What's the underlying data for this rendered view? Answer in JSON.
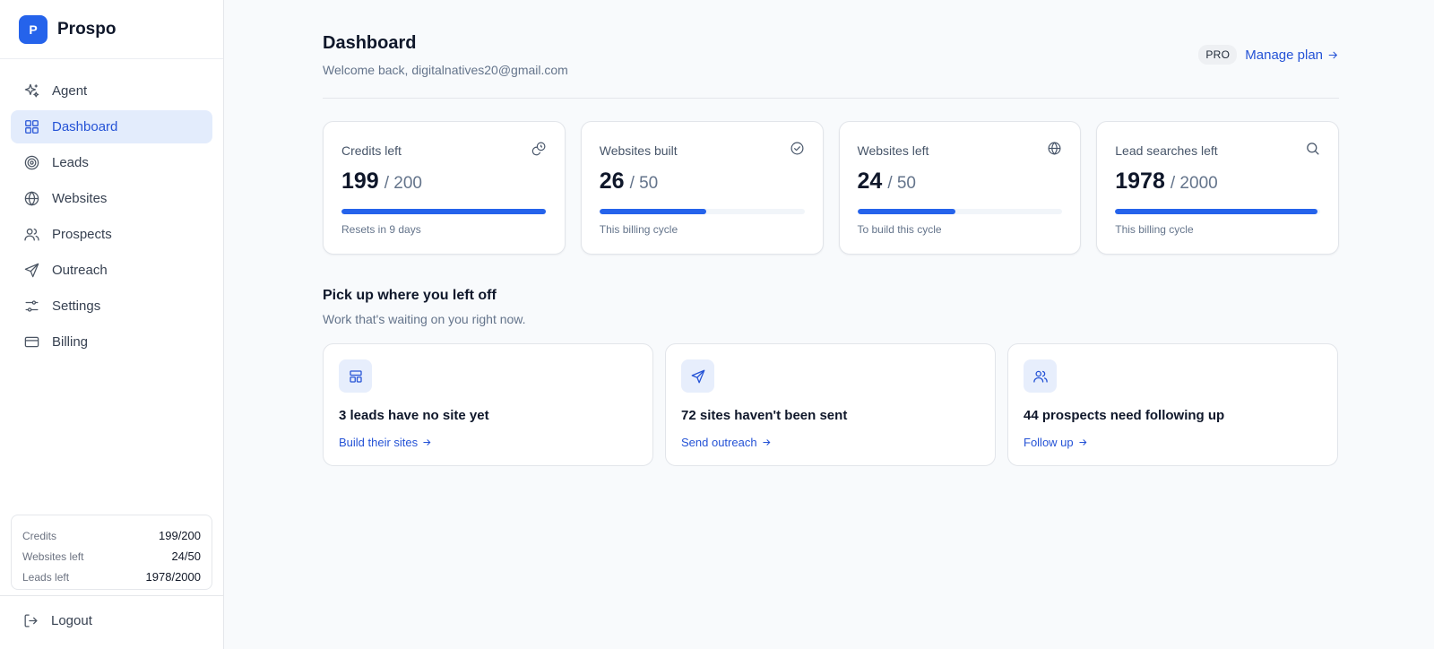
{
  "brand": {
    "logo_letter": "P",
    "name": "Prospo"
  },
  "sidebar": {
    "items": [
      {
        "label": "Agent",
        "icon": "sparkles-icon",
        "active": false
      },
      {
        "label": "Dashboard",
        "icon": "grid-icon",
        "active": true
      },
      {
        "label": "Leads",
        "icon": "target-icon",
        "active": false
      },
      {
        "label": "Websites",
        "icon": "globe-icon",
        "active": false
      },
      {
        "label": "Prospects",
        "icon": "users-icon",
        "active": false
      },
      {
        "label": "Outreach",
        "icon": "send-icon",
        "active": false
      },
      {
        "label": "Settings",
        "icon": "sliders-icon",
        "active": false
      },
      {
        "label": "Billing",
        "icon": "credit-card-icon",
        "active": false
      }
    ],
    "usage": [
      {
        "label": "Credits",
        "value": "199/200"
      },
      {
        "label": "Websites left",
        "value": "24/50"
      },
      {
        "label": "Leads left",
        "value": "1978/2000"
      }
    ],
    "logout_label": "Logout"
  },
  "header": {
    "title": "Dashboard",
    "subtitle": "Welcome back, digitalnatives20@gmail.com",
    "plan_badge": "PRO",
    "manage_plan": "Manage plan"
  },
  "stats": [
    {
      "label": "Credits left",
      "icon": "coins-icon",
      "value": "199",
      "total": "/ 200",
      "progress": 0.995,
      "note": "Resets in 9 days"
    },
    {
      "label": "Websites built",
      "icon": "check-circle-icon",
      "value": "26",
      "total": "/ 50",
      "progress": 0.52,
      "note": "This billing cycle"
    },
    {
      "label": "Websites left",
      "icon": "globe-icon",
      "value": "24",
      "total": "/ 50",
      "progress": 0.48,
      "note": "To build this cycle"
    },
    {
      "label": "Lead searches left",
      "icon": "search-icon",
      "value": "1978",
      "total": "/ 2000",
      "progress": 0.989,
      "note": "This billing cycle"
    }
  ],
  "section": {
    "title": "Pick up where you left off",
    "subtitle": "Work that's waiting on you right now."
  },
  "tasks": [
    {
      "icon": "layout-icon",
      "title": "3 leads have no site yet",
      "link": "Build their sites"
    },
    {
      "icon": "send-icon",
      "title": "72 sites haven't been sent",
      "link": "Send outreach"
    },
    {
      "icon": "users-icon",
      "title": "44 prospects need following up",
      "link": "Follow up"
    }
  ],
  "colors": {
    "accent": "#2563eb",
    "active_bg": "#e3ecfc"
  }
}
